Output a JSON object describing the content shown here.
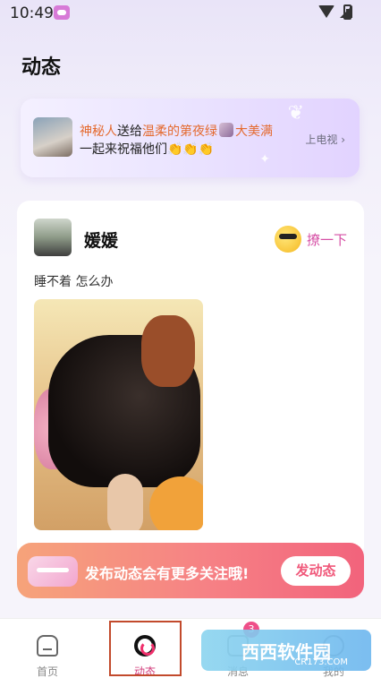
{
  "status_bar": {
    "time": "10:49"
  },
  "header": {
    "title": "动态"
  },
  "banner": {
    "sender": "神秘人",
    "sent_to": "送给",
    "recipient": "温柔的第夜绿",
    "gift_name": "大美满",
    "line2": "一起来祝福他们👏👏👏",
    "tv_label": "上电视 ›"
  },
  "post": {
    "username": "媛媛",
    "flirt_label": "撩一下",
    "text": "睡不着 怎么办"
  },
  "publish_bar": {
    "message": "发布动态会有更多关注哦!",
    "button": "发动态"
  },
  "tabs": [
    {
      "label": "首页",
      "icon": "home-icon"
    },
    {
      "label": "动态",
      "icon": "dynamic-icon",
      "active": true
    },
    {
      "label": "消息",
      "icon": "message-icon",
      "badge": "3"
    },
    {
      "label": "我的",
      "icon": "profile-icon"
    }
  ],
  "watermark": {
    "text": "西西软件园",
    "sub": "CR173.COM"
  },
  "colors": {
    "accent": "#d23b7a",
    "publish_start": "#f6a37a",
    "publish_end": "#f2637c"
  }
}
